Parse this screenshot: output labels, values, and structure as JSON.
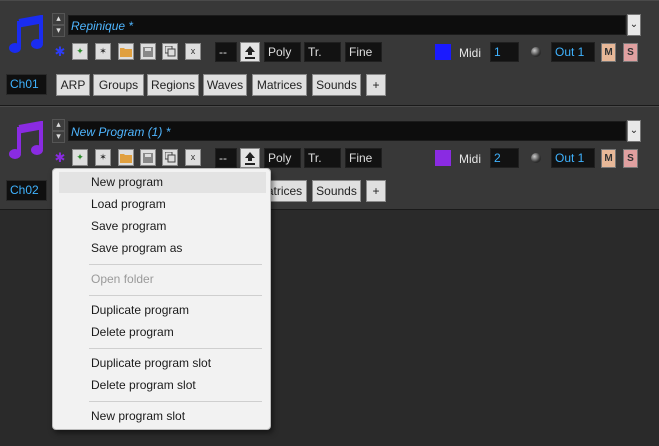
{
  "slots": [
    {
      "name": "Repinique *",
      "channel": "Ch01",
      "note_color": "#1a2cf0",
      "gear_color": "#2d3cf5",
      "color_swatch": "#1a1aff",
      "range": "--",
      "mode": "Poly",
      "transpose": "Tr.",
      "fine": "Fine",
      "midi_label": "Midi",
      "midi_channel": "1",
      "output": "Out 1",
      "mute": "M",
      "solo": "S",
      "tabs": [
        "ARP",
        "Groups",
        "Regions",
        "Waves",
        "Matrices",
        "Sounds",
        "+"
      ]
    },
    {
      "name": "New Program (1) *",
      "channel": "Ch02",
      "note_color": "#8a2be2",
      "gear_color": "#8a2be2",
      "color_swatch": "#8a2be2",
      "range": "--",
      "mode": "Poly",
      "transpose": "Tr.",
      "fine": "Fine",
      "midi_label": "Midi",
      "midi_channel": "2",
      "output": "Out 1",
      "mute": "M",
      "solo": "S",
      "tabs": [
        "Matrices",
        "Sounds",
        "+"
      ]
    }
  ],
  "context_menu": {
    "items": [
      {
        "label": "New program",
        "highlighted": true
      },
      {
        "label": "Load program"
      },
      {
        "label": "Save program"
      },
      {
        "label": "Save program as"
      },
      {
        "separator": true
      },
      {
        "label": "Open folder",
        "disabled": true
      },
      {
        "separator": true
      },
      {
        "label": "Duplicate program"
      },
      {
        "label": "Delete program"
      },
      {
        "separator": true
      },
      {
        "label": "Duplicate program slot"
      },
      {
        "label": "Delete program slot"
      },
      {
        "separator": true
      },
      {
        "label": "New program slot"
      }
    ]
  },
  "icons": {
    "spin_up": "▴",
    "spin_down": "▾",
    "dropdown": "⌄",
    "gear": "✱",
    "star_green": "✦",
    "star": "✶",
    "close": "x",
    "plus": "+"
  }
}
